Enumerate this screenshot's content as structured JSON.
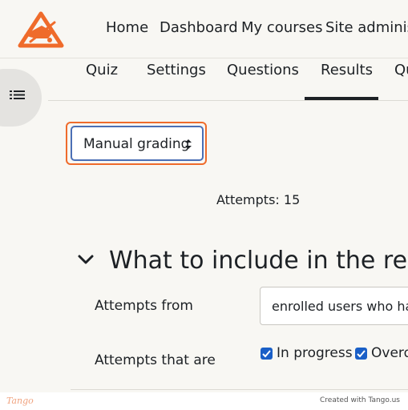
{
  "navbar": {
    "items": [
      "Home",
      "Dashboard",
      "My courses",
      "Site administration"
    ]
  },
  "tabs": {
    "items": [
      "Quiz",
      "Settings",
      "Questions",
      "Results",
      "Question bank"
    ],
    "active": "Results"
  },
  "report_select": {
    "value": "Manual grading"
  },
  "attempts_count": "Attempts: 15",
  "section": {
    "title": "What to include in the report",
    "attempts_from_label": "Attempts from",
    "attempts_from_value": "enrolled users who have attempted the quiz",
    "attempts_that_are_label": "Attempts that are",
    "checkbox_in_progress": "In progress",
    "checkbox_overdue": "Overdue"
  },
  "footer": {
    "brand": "Tango",
    "credit": "Created with Tango.us"
  },
  "colors": {
    "accent": "#ef6b2b",
    "checkbox": "#1a5fc7",
    "background": "#f8f7f3"
  }
}
